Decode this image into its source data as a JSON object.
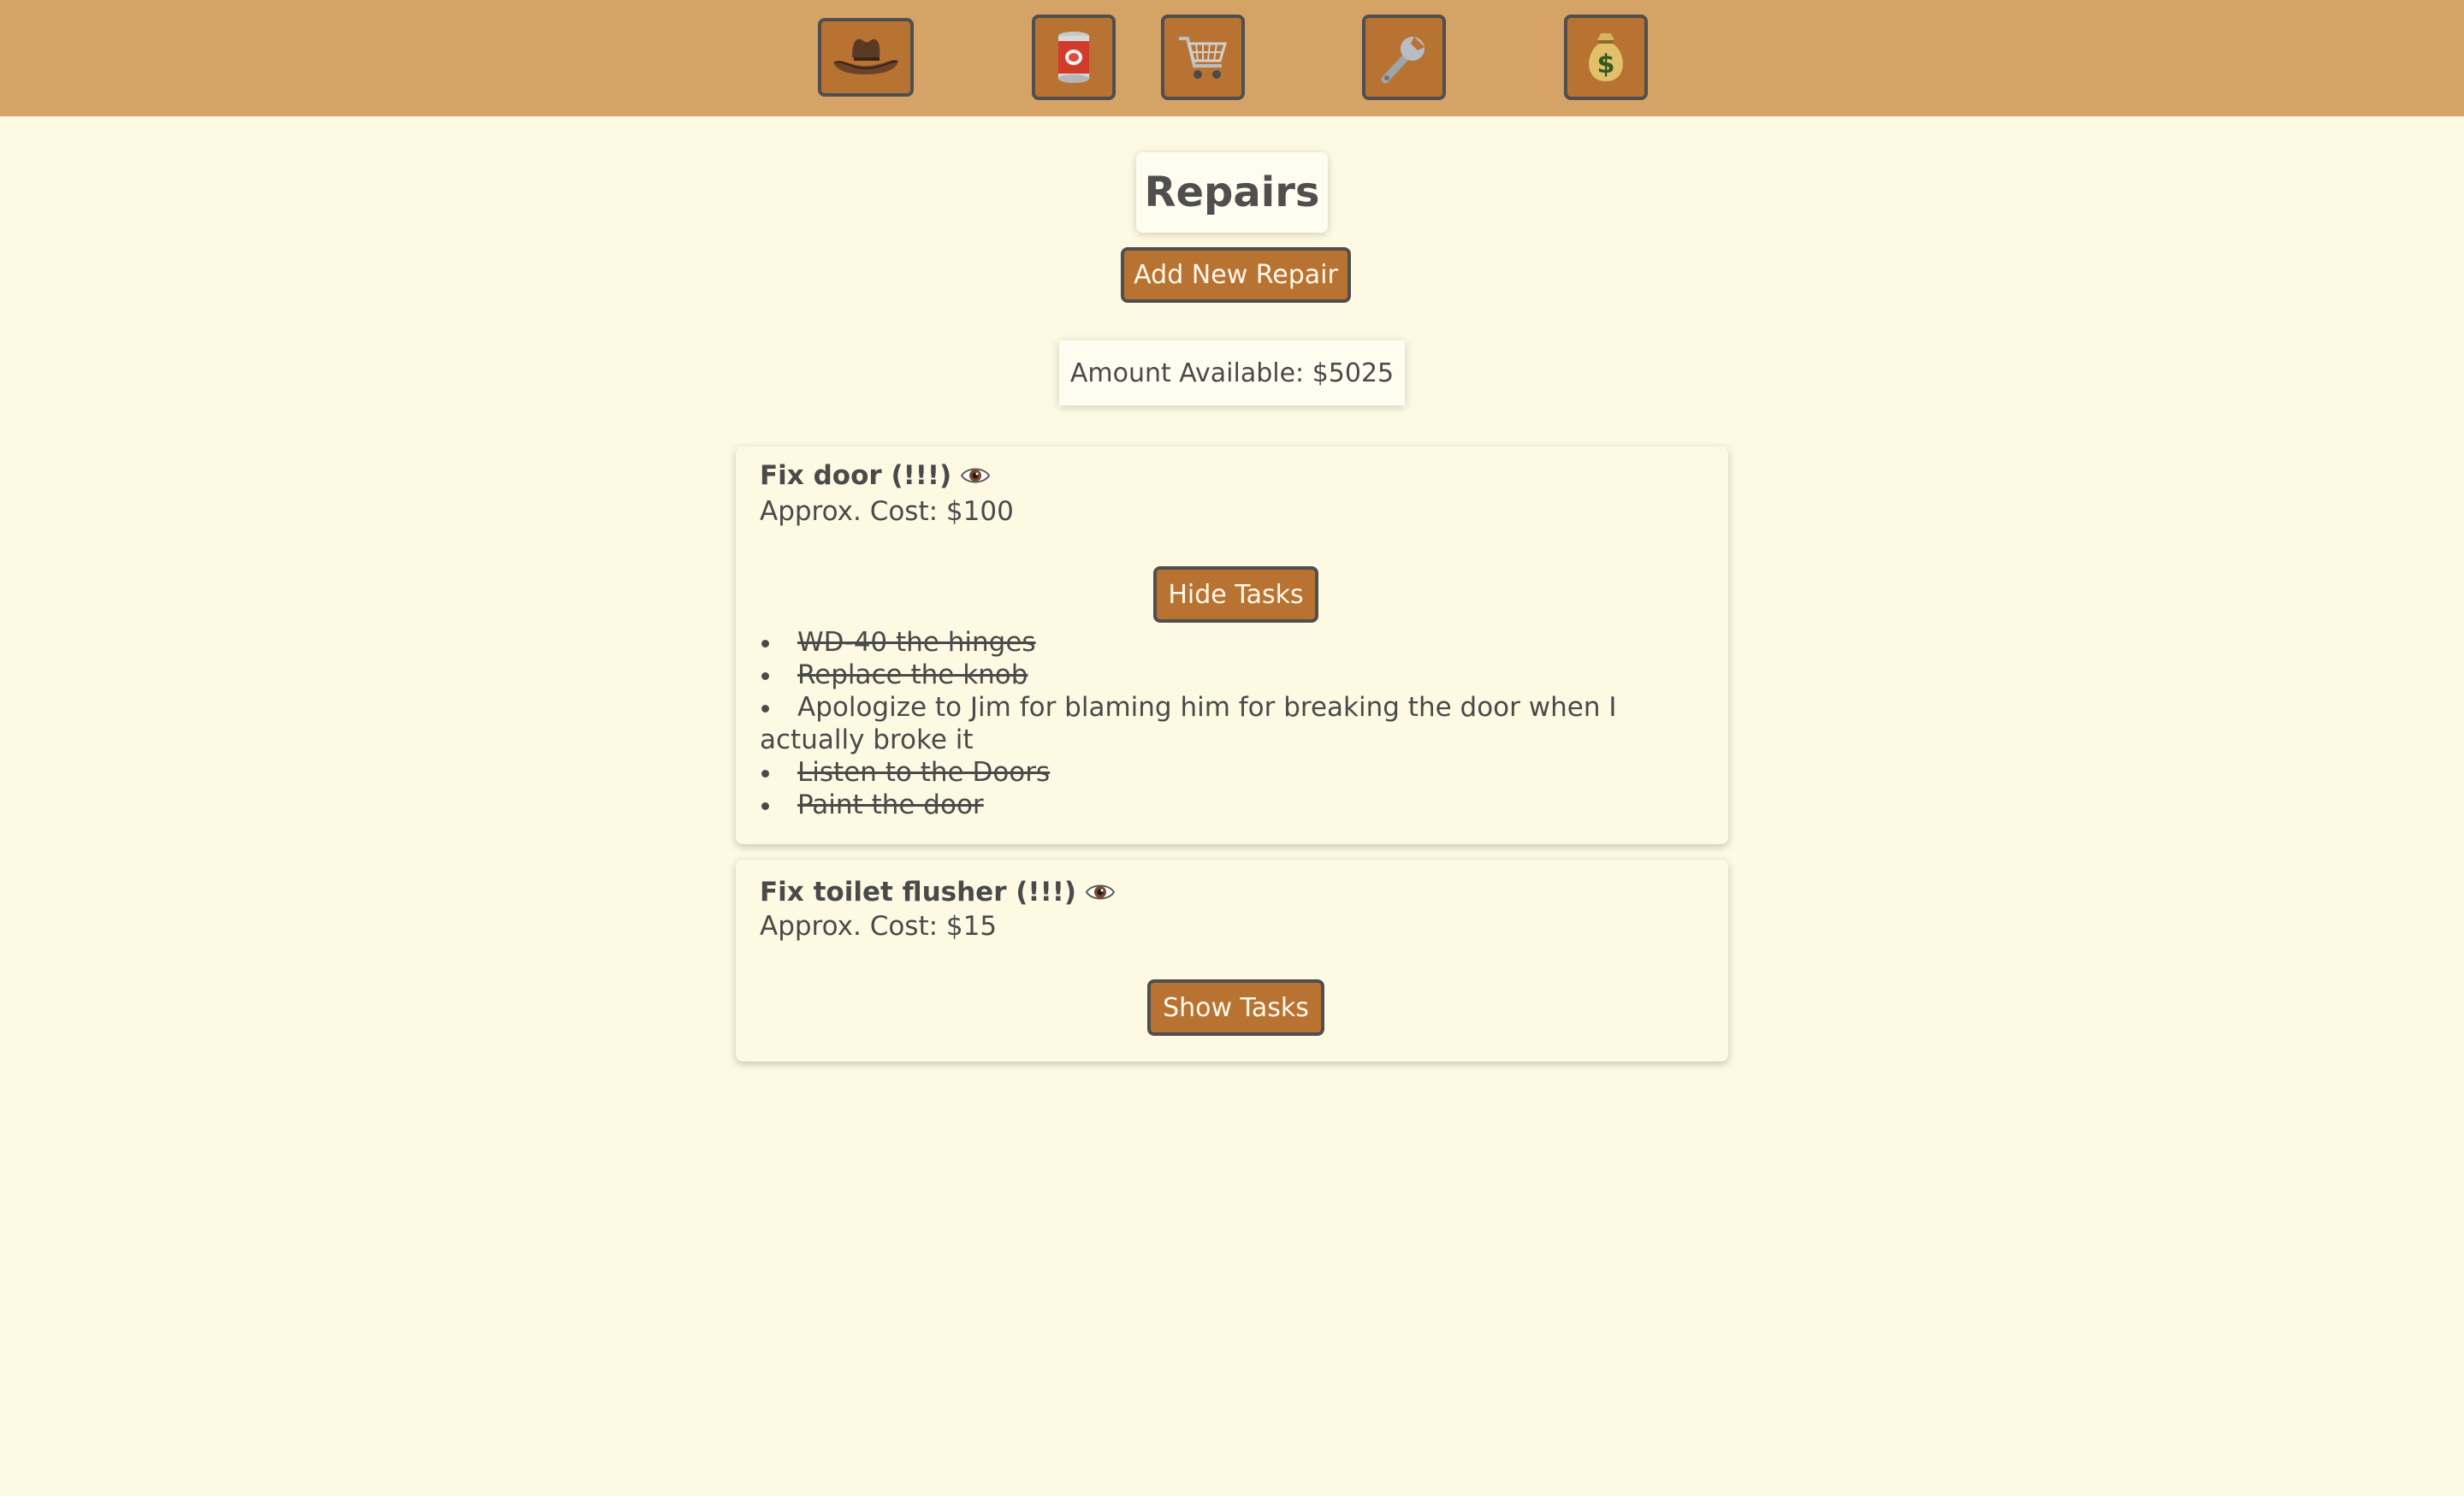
{
  "nav": {
    "items": [
      {
        "icon": "cowboy-hat-icon",
        "label": "Home"
      },
      {
        "icon": "can-icon",
        "label": "Pantry"
      },
      {
        "icon": "shopping-cart-icon",
        "label": "Shopping"
      },
      {
        "icon": "wrench-icon",
        "label": "Repairs"
      },
      {
        "icon": "money-bag-icon",
        "label": "Budget"
      }
    ]
  },
  "page": {
    "title": "Repairs",
    "add_button_label": "Add New Repair",
    "amount_available": "Amount Available: $5025"
  },
  "repairs": [
    {
      "title": "Fix door (!!!)",
      "cost": "Approx. Cost: $100",
      "toggle_label": "Hide Tasks",
      "tasks": [
        {
          "text": "WD-40 the hinges",
          "done": true
        },
        {
          "text": "Replace the knob",
          "done": true
        },
        {
          "text": "Apologize to Jim for blaming him for breaking the door when I actually broke it",
          "done": false
        },
        {
          "text": "Listen to the Doors",
          "done": true
        },
        {
          "text": "Paint the door",
          "done": true
        }
      ]
    },
    {
      "title": "Fix toilet flusher (!!!)",
      "cost": "Approx. Cost: $15",
      "toggle_label": "Show Tasks",
      "tasks": []
    }
  ],
  "colors": {
    "topbar": "#d4a365",
    "background": "#fdf9e3",
    "button": "#b87333",
    "button_border": "#4f4f4f",
    "text": "#4a4a4a"
  }
}
